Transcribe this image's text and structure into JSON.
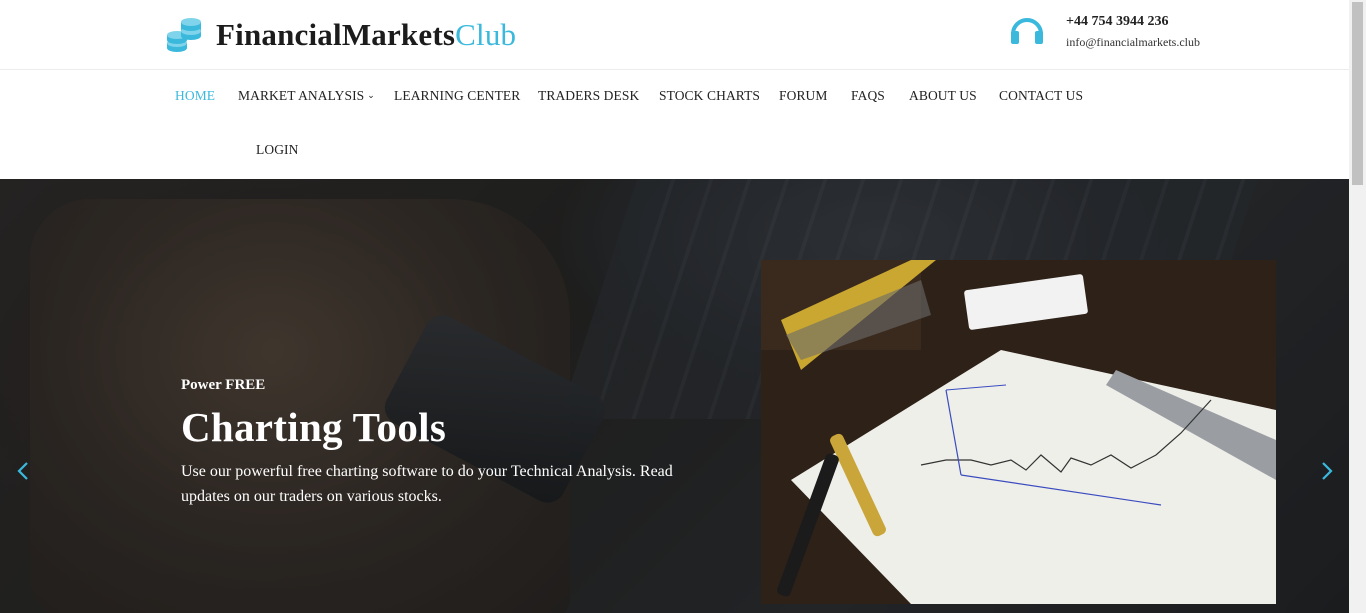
{
  "brand": {
    "name_main": "FinancialMarkets",
    "name_accent": "Club",
    "accent_color": "#3bb9dd"
  },
  "contact": {
    "phone": "+44 754 3944 236",
    "email": "info@financialmarkets.club",
    "icon": "headset-icon"
  },
  "nav": {
    "items": [
      {
        "label": "HOME",
        "active": true
      },
      {
        "label": "MARKET ANALYSIS",
        "has_dropdown": true
      },
      {
        "label": "LEARNING CENTER"
      },
      {
        "label": "TRADERS DESK"
      },
      {
        "label": "STOCK CHARTS"
      },
      {
        "label": "FORUM"
      },
      {
        "label": "FAQS"
      },
      {
        "label": "ABOUT US"
      },
      {
        "label": "CONTACT US"
      },
      {
        "label": "LOGIN"
      }
    ]
  },
  "hero": {
    "kicker": "Power FREE",
    "title": "Charting Tools",
    "text": "Use our powerful free charting software to do your Technical Analysis. Read updates on our traders on various stocks.",
    "prev_icon": "chevron-left-icon",
    "next_icon": "chevron-right-icon"
  }
}
